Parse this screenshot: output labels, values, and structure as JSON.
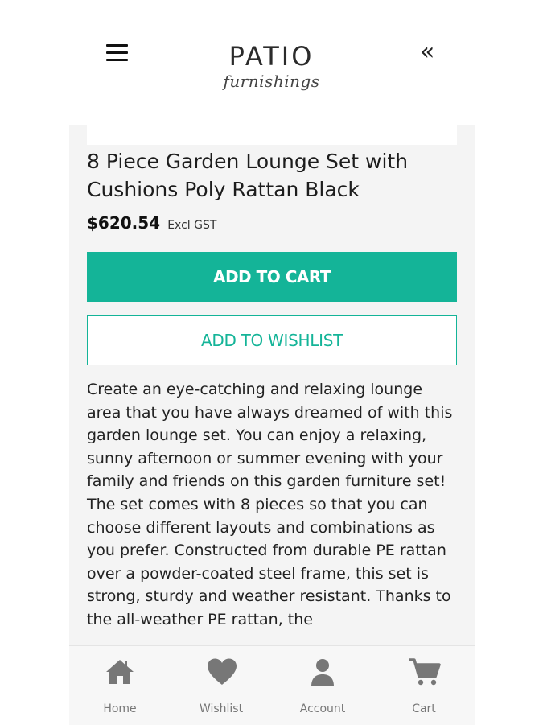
{
  "header": {
    "logo_main": "PATIO",
    "logo_sub": "furnishings",
    "menu_icon": "hamburger-menu-icon",
    "collapse_icon": "double-chevron-left-icon",
    "collapse_glyph": "«"
  },
  "product": {
    "title": "8 Piece Garden Lounge Set with Cushions Poly Rattan Black",
    "price": "$620.54",
    "tax_note": "Excl GST",
    "add_to_cart_label": "ADD TO CART",
    "add_to_wishlist_label": "ADD TO WISHLIST",
    "description": "Create an eye-catching and relaxing lounge area that you have always dreamed of with this garden lounge set. You can enjoy a relaxing, sunny afternoon or summer evening with your family and friends on this garden furniture set! The set comes with 8 pieces so that you can choose different layouts and combinations as you prefer. Constructed from durable PE rattan over a powder-coated steel frame, this set is strong, sturdy and weather resistant. Thanks to the all-weather PE rattan, the"
  },
  "bottom_nav": {
    "items": [
      {
        "label": "Home",
        "icon": "home-icon"
      },
      {
        "label": "Wishlist",
        "icon": "heart-icon"
      },
      {
        "label": "Account",
        "icon": "user-icon"
      },
      {
        "label": "Cart",
        "icon": "cart-icon"
      }
    ]
  },
  "colors": {
    "accent": "#14b498",
    "panel_bg": "#f4f4f4",
    "nav_icon": "#777777"
  }
}
